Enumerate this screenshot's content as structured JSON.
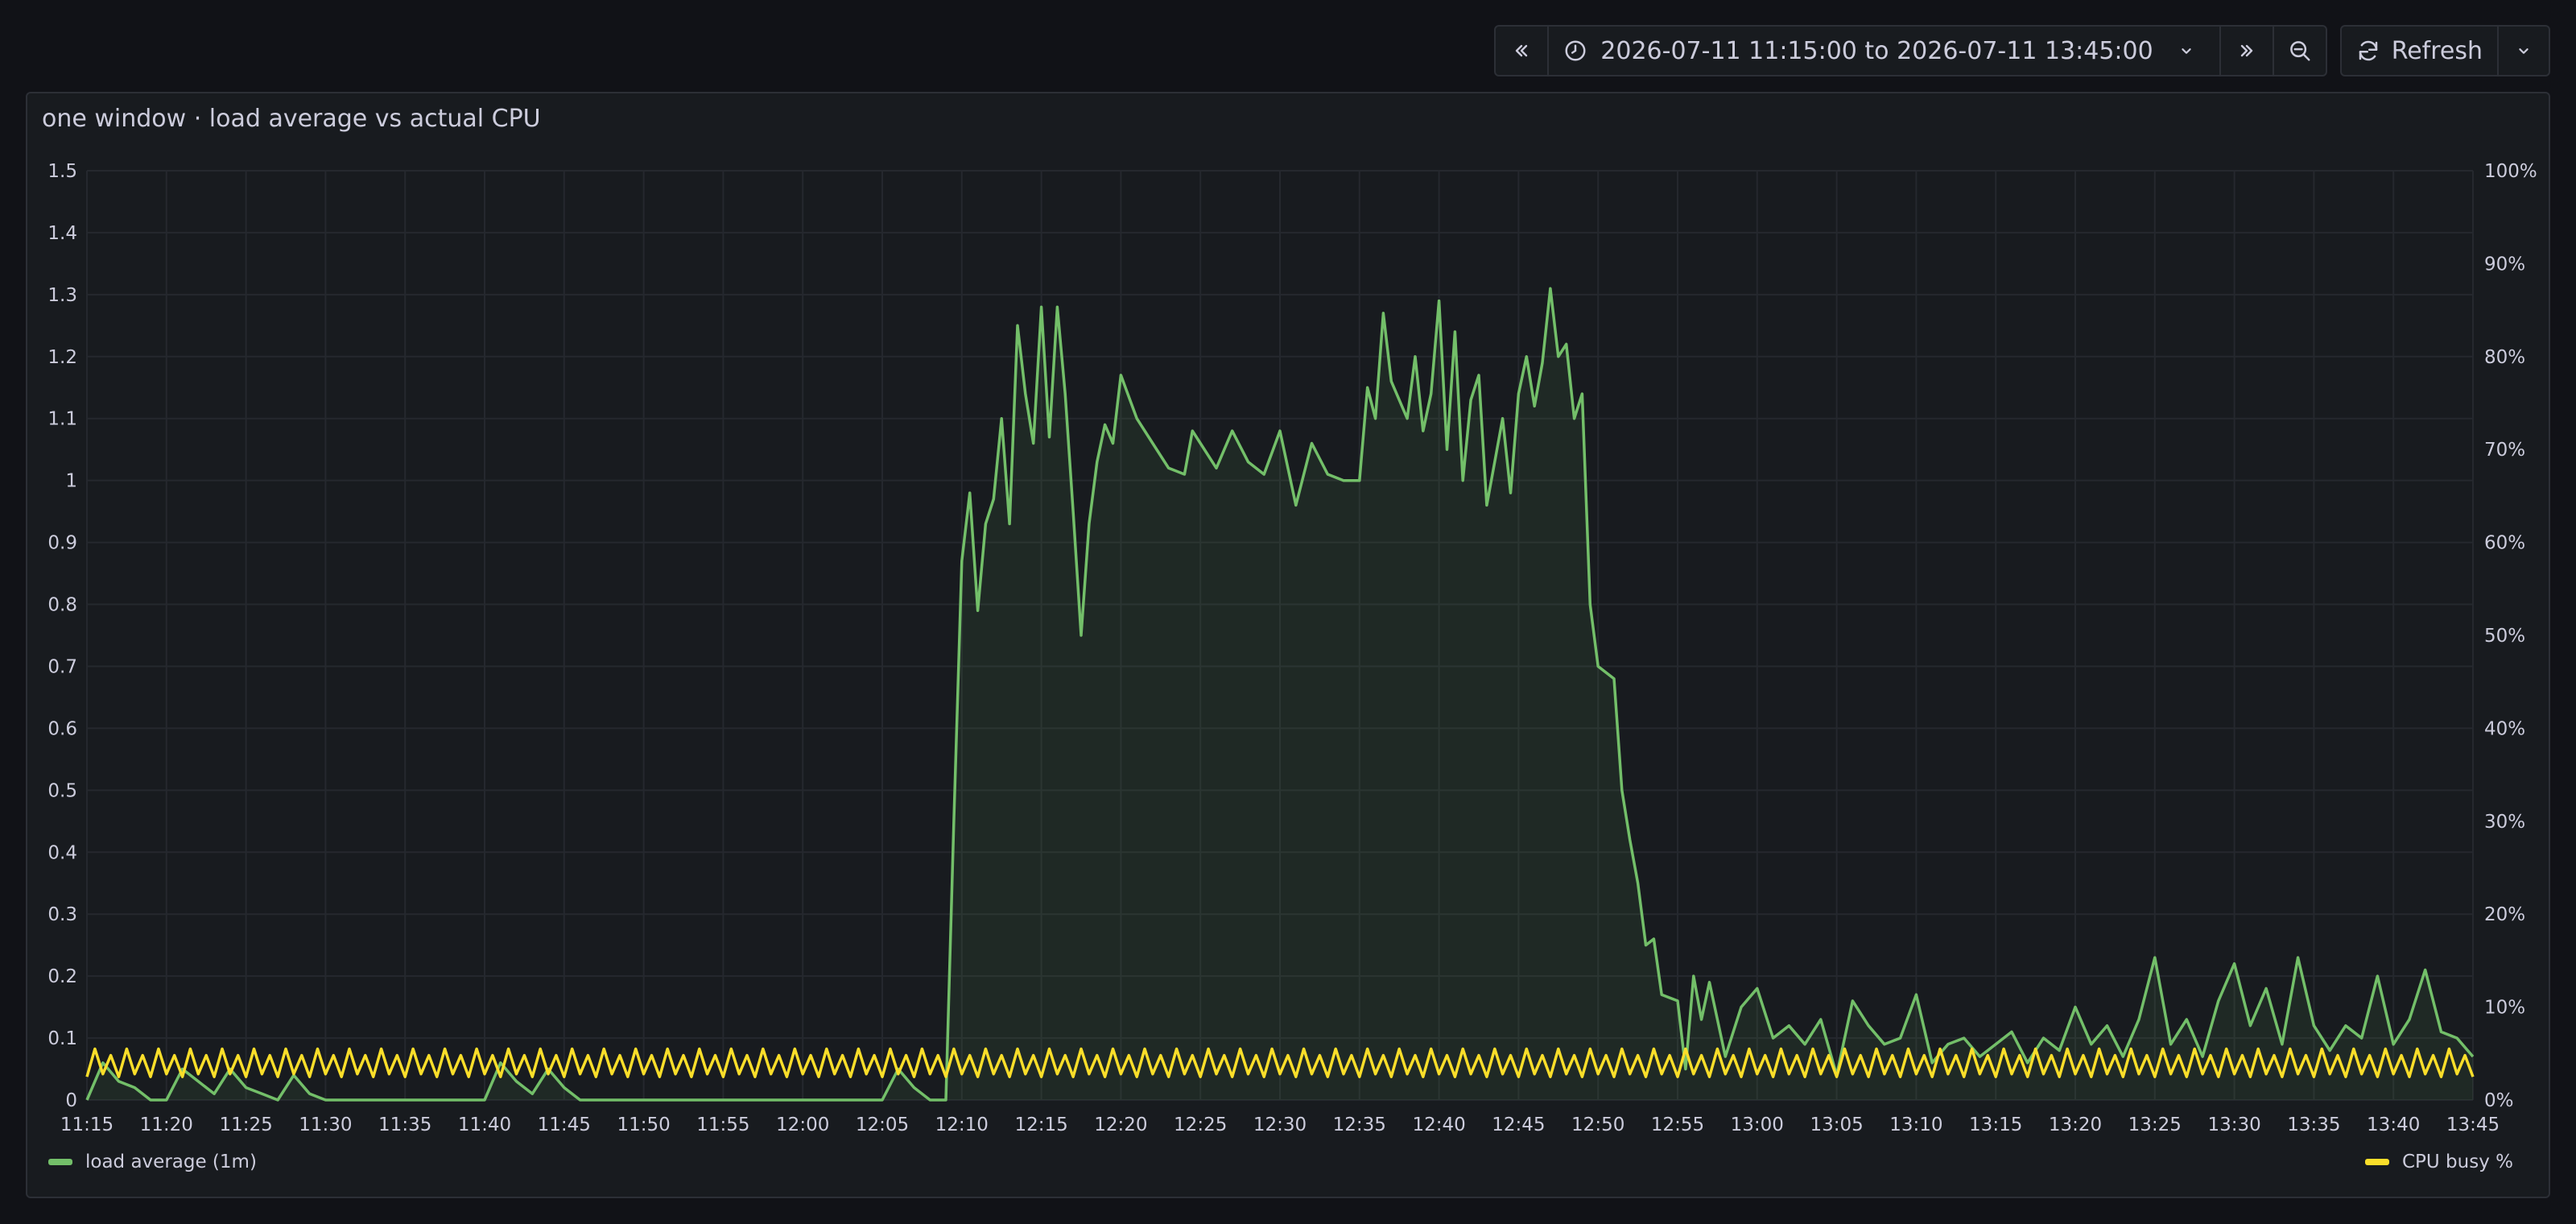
{
  "toolbar": {
    "time_range": "2026-07-11 11:15:00 to 2026-07-11 13:45:00",
    "refresh_label": "Refresh"
  },
  "panel": {
    "title": "one window · load average vs actual CPU"
  },
  "colors": {
    "load": "#73bf69",
    "cpu": "#fade2a",
    "grid": "#25282e",
    "text": "#ccccdc",
    "background": "#181b1f"
  },
  "chart_data": {
    "type": "line",
    "x_ticks": [
      "11:15",
      "11:20",
      "11:25",
      "11:30",
      "11:35",
      "11:40",
      "11:45",
      "11:50",
      "11:55",
      "12:00",
      "12:05",
      "12:10",
      "12:15",
      "12:20",
      "12:25",
      "12:30",
      "12:35",
      "12:40",
      "12:45",
      "12:50",
      "12:55",
      "13:00",
      "13:05",
      "13:10",
      "13:15",
      "13:20",
      "13:25",
      "13:30",
      "13:35",
      "13:40",
      "13:45"
    ],
    "y_left_ticks": [
      "0",
      "0.1",
      "0.2",
      "0.3",
      "0.4",
      "0.5",
      "0.6",
      "0.7",
      "0.8",
      "0.9",
      "1",
      "1.1",
      "1.2",
      "1.3",
      "1.4",
      "1.5"
    ],
    "y_right_ticks": [
      "0%",
      "10%",
      "20%",
      "30%",
      "40%",
      "50%",
      "60%",
      "70%",
      "80%",
      "90%",
      "100%"
    ],
    "y_left_range": [
      0,
      1.5
    ],
    "y_right_range": [
      0,
      100
    ],
    "grid": true,
    "legend_placement": "bottom",
    "series": [
      {
        "name": "load average (1m)",
        "axis": "left",
        "fill": true,
        "points": [
          [
            "11:15",
            0.0
          ],
          [
            "11:16",
            0.06
          ],
          [
            "11:17",
            0.03
          ],
          [
            "11:18",
            0.02
          ],
          [
            "11:19",
            0.0
          ],
          [
            "11:20",
            0.0
          ],
          [
            "11:21",
            0.05
          ],
          [
            "11:22",
            0.03
          ],
          [
            "11:23",
            0.01
          ],
          [
            "11:24",
            0.05
          ],
          [
            "11:25",
            0.02
          ],
          [
            "11:26",
            0.01
          ],
          [
            "11:27",
            0.0
          ],
          [
            "11:28",
            0.04
          ],
          [
            "11:29",
            0.01
          ],
          [
            "11:30",
            0.0
          ],
          [
            "11:31",
            0.0
          ],
          [
            "11:32",
            0.0
          ],
          [
            "11:33",
            0.0
          ],
          [
            "11:34",
            0.0
          ],
          [
            "11:35",
            0.0
          ],
          [
            "11:36",
            0.0
          ],
          [
            "11:37",
            0.0
          ],
          [
            "11:38",
            0.0
          ],
          [
            "11:39",
            0.0
          ],
          [
            "11:40",
            0.0
          ],
          [
            "11:41",
            0.06
          ],
          [
            "11:42",
            0.03
          ],
          [
            "11:43",
            0.01
          ],
          [
            "11:44",
            0.05
          ],
          [
            "11:45",
            0.02
          ],
          [
            "11:46",
            0.0
          ],
          [
            "11:47",
            0.0
          ],
          [
            "11:48",
            0.0
          ],
          [
            "11:49",
            0.0
          ],
          [
            "11:50",
            0.0
          ],
          [
            "11:51",
            0.0
          ],
          [
            "11:52",
            0.0
          ],
          [
            "11:53",
            0.0
          ],
          [
            "11:54",
            0.0
          ],
          [
            "11:55",
            0.0
          ],
          [
            "11:56",
            0.0
          ],
          [
            "11:57",
            0.0
          ],
          [
            "11:58",
            0.0
          ],
          [
            "11:59",
            0.0
          ],
          [
            "12:00",
            0.0
          ],
          [
            "12:01",
            0.0
          ],
          [
            "12:02",
            0.0
          ],
          [
            "12:03",
            0.0
          ],
          [
            "12:04",
            0.0
          ],
          [
            "12:05",
            0.0
          ],
          [
            "12:06",
            0.05
          ],
          [
            "12:07",
            0.02
          ],
          [
            "12:08",
            0.0
          ],
          [
            "12:09",
            0.0
          ],
          [
            "12:09.5",
            0.45
          ],
          [
            "12:10",
            0.87
          ],
          [
            "12:10.5",
            0.98
          ],
          [
            "12:11",
            0.79
          ],
          [
            "12:11.5",
            0.93
          ],
          [
            "12:12",
            0.97
          ],
          [
            "12:12.5",
            1.1
          ],
          [
            "12:13",
            0.93
          ],
          [
            "12:13.5",
            1.25
          ],
          [
            "12:14",
            1.14
          ],
          [
            "12:14.5",
            1.06
          ],
          [
            "12:15",
            1.28
          ],
          [
            "12:15.5",
            1.07
          ],
          [
            "12:16",
            1.28
          ],
          [
            "12:16.5",
            1.14
          ],
          [
            "12:17",
            0.95
          ],
          [
            "12:17.5",
            0.75
          ],
          [
            "12:18",
            0.93
          ],
          [
            "12:18.5",
            1.03
          ],
          [
            "12:19",
            1.09
          ],
          [
            "12:19.5",
            1.06
          ],
          [
            "12:20",
            1.17
          ],
          [
            "12:21",
            1.1
          ],
          [
            "12:22",
            1.06
          ],
          [
            "12:23",
            1.02
          ],
          [
            "12:24",
            1.01
          ],
          [
            "12:24.5",
            1.08
          ],
          [
            "12:25",
            1.06
          ],
          [
            "12:26",
            1.02
          ],
          [
            "12:27",
            1.08
          ],
          [
            "12:28",
            1.03
          ],
          [
            "12:29",
            1.01
          ],
          [
            "12:30",
            1.08
          ],
          [
            "12:31",
            0.96
          ],
          [
            "12:32",
            1.06
          ],
          [
            "12:33",
            1.01
          ],
          [
            "12:34",
            1.0
          ],
          [
            "12:35",
            1.0
          ],
          [
            "12:35.5",
            1.15
          ],
          [
            "12:36",
            1.1
          ],
          [
            "12:36.5",
            1.27
          ],
          [
            "12:37",
            1.16
          ],
          [
            "12:38",
            1.1
          ],
          [
            "12:38.5",
            1.2
          ],
          [
            "12:39",
            1.08
          ],
          [
            "12:39.5",
            1.14
          ],
          [
            "12:40",
            1.29
          ],
          [
            "12:40.5",
            1.05
          ],
          [
            "12:41",
            1.24
          ],
          [
            "12:41.5",
            1.0
          ],
          [
            "12:42",
            1.13
          ],
          [
            "12:42.5",
            1.17
          ],
          [
            "12:43",
            0.96
          ],
          [
            "12:43.5",
            1.03
          ],
          [
            "12:44",
            1.1
          ],
          [
            "12:44.5",
            0.98
          ],
          [
            "12:45",
            1.14
          ],
          [
            "12:45.5",
            1.2
          ],
          [
            "12:46",
            1.12
          ],
          [
            "12:46.5",
            1.19
          ],
          [
            "12:47",
            1.31
          ],
          [
            "12:47.5",
            1.2
          ],
          [
            "12:48",
            1.22
          ],
          [
            "12:48.5",
            1.1
          ],
          [
            "12:49",
            1.14
          ],
          [
            "12:49.5",
            0.8
          ],
          [
            "12:50",
            0.7
          ],
          [
            "12:51",
            0.68
          ],
          [
            "12:51.5",
            0.5
          ],
          [
            "12:52",
            0.42
          ],
          [
            "12:52.5",
            0.35
          ],
          [
            "12:53",
            0.25
          ],
          [
            "12:53.5",
            0.26
          ],
          [
            "12:54",
            0.17
          ],
          [
            "12:55",
            0.16
          ],
          [
            "12:55.5",
            0.05
          ],
          [
            "12:56",
            0.2
          ],
          [
            "12:56.5",
            0.13
          ],
          [
            "12:57",
            0.19
          ],
          [
            "12:58",
            0.07
          ],
          [
            "12:59",
            0.15
          ],
          [
            "13:00",
            0.18
          ],
          [
            "13:01",
            0.1
          ],
          [
            "13:02",
            0.12
          ],
          [
            "13:03",
            0.09
          ],
          [
            "13:04",
            0.13
          ],
          [
            "13:05",
            0.04
          ],
          [
            "13:06",
            0.16
          ],
          [
            "13:07",
            0.12
          ],
          [
            "13:08",
            0.09
          ],
          [
            "13:09",
            0.1
          ],
          [
            "13:10",
            0.17
          ],
          [
            "13:11",
            0.06
          ],
          [
            "13:12",
            0.09
          ],
          [
            "13:13",
            0.1
          ],
          [
            "13:14",
            0.07
          ],
          [
            "13:15",
            0.09
          ],
          [
            "13:16",
            0.11
          ],
          [
            "13:17",
            0.06
          ],
          [
            "13:18",
            0.1
          ],
          [
            "13:19",
            0.08
          ],
          [
            "13:20",
            0.15
          ],
          [
            "13:21",
            0.09
          ],
          [
            "13:22",
            0.12
          ],
          [
            "13:23",
            0.07
          ],
          [
            "13:24",
            0.13
          ],
          [
            "13:25",
            0.23
          ],
          [
            "13:26",
            0.09
          ],
          [
            "13:27",
            0.13
          ],
          [
            "13:28",
            0.07
          ],
          [
            "13:29",
            0.16
          ],
          [
            "13:30",
            0.22
          ],
          [
            "13:31",
            0.12
          ],
          [
            "13:32",
            0.18
          ],
          [
            "13:33",
            0.09
          ],
          [
            "13:34",
            0.23
          ],
          [
            "13:35",
            0.12
          ],
          [
            "13:36",
            0.08
          ],
          [
            "13:37",
            0.12
          ],
          [
            "13:38",
            0.1
          ],
          [
            "13:39",
            0.2
          ],
          [
            "13:40",
            0.09
          ],
          [
            "13:41",
            0.13
          ],
          [
            "13:42",
            0.21
          ],
          [
            "13:43",
            0.11
          ],
          [
            "13:44",
            0.1
          ],
          [
            "13:45",
            0.07
          ]
        ]
      },
      {
        "name": "CPU busy %",
        "axis": "right",
        "fill": false,
        "points_per_minute": 2,
        "pattern_percent": [
          2.5,
          5.5,
          2.8,
          4.8
        ]
      }
    ]
  }
}
